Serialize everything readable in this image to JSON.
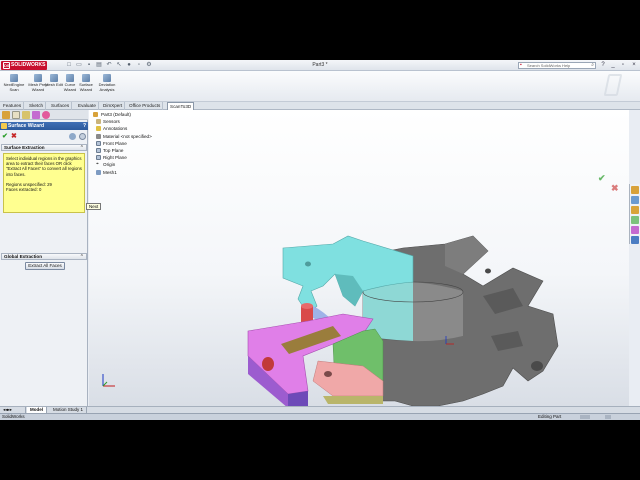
{
  "app": {
    "brand": "SOLIDWORKS",
    "document_title": "Part3 *",
    "search_placeholder": "Search SolidWorks Help"
  },
  "colors": {
    "brand_red": "#c8102e",
    "wizard_header": "#2d5a9c",
    "message_yellow": "#ffff90",
    "face_cyan": "#7fe0e0",
    "face_magenta": "#e07fe8",
    "face_green": "#6fbf6a",
    "body_gray": "#6f6f6f"
  },
  "ribbon": {
    "buttons": [
      {
        "label": "NextEngine Scan",
        "icon": "scanner-icon"
      },
      {
        "label": "Mesh Prep Wizard",
        "icon": "mesh-prep-icon"
      },
      {
        "label": "Mesh Edit",
        "icon": "mesh-edit-icon"
      },
      {
        "label": "Curve Wizard",
        "icon": "curve-wizard-icon"
      },
      {
        "label": "Surface Wizard",
        "icon": "surface-wizard-icon"
      },
      {
        "label": "Deviation Analysis",
        "icon": "deviation-icon"
      }
    ]
  },
  "tabs": [
    {
      "label": "Features"
    },
    {
      "label": "Sketch"
    },
    {
      "label": "Surfaces"
    },
    {
      "label": "Evaluate"
    },
    {
      "label": "DimXpert"
    },
    {
      "label": "Office Products"
    },
    {
      "label": "ScanTo3D",
      "active": true
    }
  ],
  "property_manager": {
    "title": "Surface Wizard",
    "help": "?",
    "tooltip": "Next",
    "surface_extraction": {
      "heading": "Surface Extraction",
      "message": "Select individual regions in the graphics area to extract their faces OR click \"Extract All Faces\" to convert all regions into faces.",
      "regions_unspecified": "Regions unspecified: 29",
      "faces_extracted": "Faces extracted: 0"
    },
    "global_extraction": {
      "heading": "Global Extraction",
      "button": "Extract All Faces"
    }
  },
  "feature_tree": [
    {
      "label": "Part3  (Default)",
      "icon": "part-icon"
    },
    {
      "label": "Sensors",
      "icon": "sensor-icon"
    },
    {
      "label": "Annotations",
      "icon": "annotation-icon"
    },
    {
      "label": "Material <not specified>",
      "icon": "material-icon"
    },
    {
      "label": "Front Plane",
      "icon": "plane-icon"
    },
    {
      "label": "Top Plane",
      "icon": "plane-icon"
    },
    {
      "label": "Right Plane",
      "icon": "plane-icon"
    },
    {
      "label": "Origin",
      "icon": "origin-icon"
    },
    {
      "label": "Mesh1",
      "icon": "mesh-icon"
    }
  ],
  "bottom_tabs": [
    {
      "label": "Model",
      "active": true
    },
    {
      "label": "Motion Study 1"
    }
  ],
  "status": {
    "app": "SolidWorks",
    "mode": "Editing Part"
  }
}
